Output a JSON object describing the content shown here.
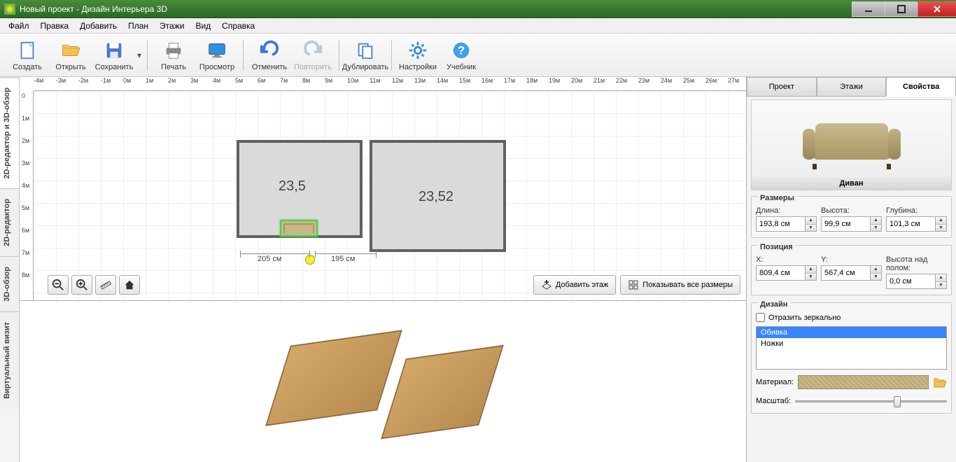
{
  "title": "Новый проект - Дизайн Интерьера 3D",
  "menu": [
    "Файл",
    "Правка",
    "Добавить",
    "План",
    "Этажи",
    "Вид",
    "Справка"
  ],
  "toolbar": {
    "create": "Создать",
    "open": "Открыть",
    "save": "Сохранить",
    "print": "Печать",
    "view": "Просмотр",
    "undo": "Отменить",
    "redo": "Повторить",
    "duplicate": "Дублировать",
    "settings": "Настройки",
    "tutorial": "Учебник"
  },
  "side_tabs": [
    "2D-редактор и 3D-обзор",
    "2D-редактор",
    "3D-обзор",
    "Виртуальный визит"
  ],
  "ruler_h": [
    "-4м",
    "-3м",
    "-2м",
    "-1м",
    "0м",
    "1м",
    "2м",
    "3м",
    "4м",
    "5м",
    "6м",
    "7м",
    "8м",
    "9м",
    "10м",
    "11м",
    "12м",
    "13м",
    "14м",
    "15м",
    "16м",
    "17м",
    "18м",
    "19м",
    "20м",
    "21м",
    "22м",
    "23м",
    "24м",
    "25м",
    "26м",
    "27м"
  ],
  "ruler_v": [
    "0",
    "1м",
    "2м",
    "3м",
    "4м",
    "5м",
    "6м",
    "7м",
    "8м"
  ],
  "rooms": {
    "r1": "23,5",
    "r2": "23,52"
  },
  "dims": {
    "d1": "205 см",
    "d2": "195 см"
  },
  "canvas_buttons": {
    "add_floor": "Добавить этаж",
    "show_all_dims": "Показывать все размеры"
  },
  "right_tabs": [
    "Проект",
    "Этажи",
    "Свойства"
  ],
  "preview_caption": "Диван",
  "sizes": {
    "group": "Размеры",
    "length_label": "Длина:",
    "length": "193,8 см",
    "height_label": "Высота:",
    "height": "99,9 см",
    "depth_label": "Глубина:",
    "depth": "101,3 см"
  },
  "position": {
    "group": "Позиция",
    "x_label": "X:",
    "x": "809,4 см",
    "y_label": "Y:",
    "y": "567,4 см",
    "z_label": "Высота над полом:",
    "z": "0,0 см"
  },
  "design": {
    "group": "Дизайн",
    "mirror": "Отразить зеркально",
    "list": [
      "Обивка",
      "Ножки"
    ],
    "material_label": "Материал:",
    "scale_label": "Масштаб:"
  }
}
